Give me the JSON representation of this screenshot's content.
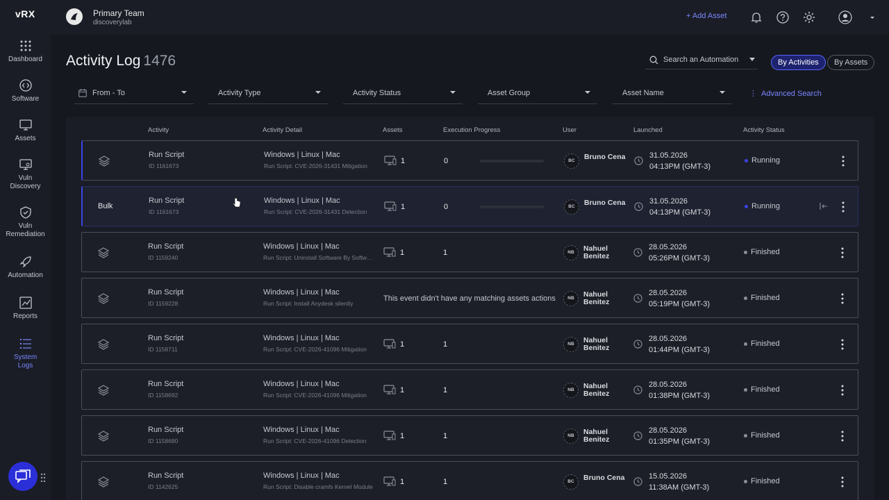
{
  "logo": {
    "text": "vRX"
  },
  "sidebar": {
    "items": [
      {
        "label": "Dashboard",
        "icon": "grid-icon"
      },
      {
        "label": "Software",
        "icon": "code-icon"
      },
      {
        "label": "Assets",
        "icon": "monitor-icon"
      },
      {
        "label": "Vuln Discovery",
        "icon": "monitor-search-icon"
      },
      {
        "label": "Vuln Remediation",
        "icon": "shield-icon"
      },
      {
        "label": "Automation",
        "icon": "rocket-icon"
      },
      {
        "label": "Reports",
        "icon": "chart-icon"
      },
      {
        "label": "System Logs",
        "icon": "list-icon",
        "active": true
      }
    ]
  },
  "topbar": {
    "team_name": "Primary Team",
    "team_sub": "discoverylab",
    "add_asset": "+ Add Asset"
  },
  "page": {
    "title": "Activity Log",
    "count": "1476",
    "search_placeholder": "Search an Automation",
    "view_by_activities": "By Activities",
    "view_by_assets": "By Assets",
    "advanced_search": "Advanced Search"
  },
  "filters": [
    {
      "label": "From - To"
    },
    {
      "label": "Activity Type"
    },
    {
      "label": "Activity Status"
    },
    {
      "label": "Asset Group"
    },
    {
      "label": "Asset Name"
    }
  ],
  "table": {
    "headers": {
      "activity": "Activity",
      "detail": "Activity Detail",
      "assets": "Assets",
      "progress": "Execution Progress",
      "user": "User",
      "launched": "Launched",
      "status": "Activity Status"
    },
    "rows": [
      {
        "type": "stack",
        "name": "Run Script",
        "id": "ID 1161673",
        "os": "Windows | Linux | Mac",
        "sub": "Run Script: CVE-2026-31431 Mitigation",
        "assets": "1",
        "progress": "0",
        "progress_frac": 0,
        "initials": "BC",
        "user": "Bruno Cena",
        "date": "31.05.2026",
        "time": "04:13PM (GMT-3)",
        "status": "Running",
        "status_color": "#3a44e6"
      },
      {
        "type": "bulk",
        "bulk_label": "Bulk",
        "name": "Run Script",
        "id": "ID 1161673",
        "os": "Windows | Linux | Mac",
        "sub": "Run Script: CVE-2026-31431 Detection",
        "assets": "1",
        "progress": "0",
        "progress_frac": 0,
        "initials": "BC",
        "user": "Bruno Cena",
        "date": "31.05.2026",
        "time": "04:13PM (GMT-3)",
        "status": "Running",
        "status_color": "#3a44e6"
      },
      {
        "type": "stack",
        "name": "Run Script",
        "id": "ID 1159240",
        "os": "Windows | Linux | Mac",
        "sub": "Run Script: Uninstall Software By Software Name",
        "assets": "1",
        "progress": "1",
        "initials": "NB",
        "user": "Nahuel Benitez",
        "date": "28.05.2026",
        "time": "05:26PM (GMT-3)",
        "status": "Finished",
        "status_color": "#8a8f99"
      },
      {
        "type": "stack",
        "name": "Run Script",
        "id": "ID 1159228",
        "os": "Windows | Linux | Mac",
        "sub": "Run Script: Install Anydesk silently",
        "no_match": "This event didn't have any matching assets actions",
        "initials": "NB",
        "user": "Nahuel Benitez",
        "date": "28.05.2026",
        "time": "05:19PM (GMT-3)",
        "status": "Finished",
        "status_color": "#8a8f99"
      },
      {
        "type": "stack",
        "name": "Run Script",
        "id": "ID 1158711",
        "os": "Windows | Linux | Mac",
        "sub": "Run Script: CVE-2026-41096 Mitigation",
        "assets": "1",
        "progress": "1",
        "initials": "NB",
        "user": "Nahuel Benitez",
        "date": "28.05.2026",
        "time": "01:44PM (GMT-3)",
        "status": "Finished",
        "status_color": "#8a8f99"
      },
      {
        "type": "stack",
        "name": "Run Script",
        "id": "ID 1158692",
        "os": "Windows | Linux | Mac",
        "sub": "Run Script: CVE-2026-41096 Mitigation",
        "assets": "1",
        "progress": "1",
        "initials": "NB",
        "user": "Nahuel Benitez",
        "date": "28.05.2026",
        "time": "01:38PM (GMT-3)",
        "status": "Finished",
        "status_color": "#8a8f99"
      },
      {
        "type": "stack",
        "name": "Run Script",
        "id": "ID 1158680",
        "os": "Windows | Linux | Mac",
        "sub": "Run Script: CVE-2026-41096 Detection",
        "assets": "1",
        "progress": "1",
        "initials": "NB",
        "user": "Nahuel Benitez",
        "date": "28.05.2026",
        "time": "01:35PM (GMT-3)",
        "status": "Finished",
        "status_color": "#8a8f99"
      },
      {
        "type": "stack",
        "name": "Run Script",
        "id": "ID 1142625",
        "os": "Windows | Linux | Mac",
        "sub": "Run Script: Disable cramfs Kernel Module",
        "assets": "1",
        "progress": "1",
        "initials": "BC",
        "user": "Bruno Cena",
        "date": "15.05.2026",
        "time": "11:38AM (GMT-3)",
        "status": "Finished",
        "status_color": "#8a8f99"
      }
    ]
  },
  "colors": {
    "accent": "#5b66ff",
    "running": "#3a44e6",
    "finished": "#8a8f99"
  }
}
